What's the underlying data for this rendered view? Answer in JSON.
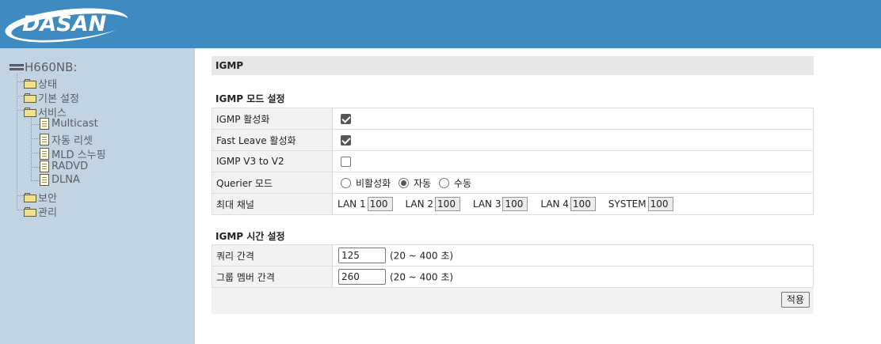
{
  "header": {
    "logo_text": "DASAN",
    "bg_color": "#3d8bc0"
  },
  "sidebar": {
    "root_label": "H660NB:",
    "items": [
      {
        "label": "상태",
        "type": "folder"
      },
      {
        "label": "기본 설정",
        "type": "folder"
      },
      {
        "label": "서비스",
        "type": "folder-open"
      },
      {
        "label": "Multicast",
        "type": "page"
      },
      {
        "label": "자동 리셋",
        "type": "page"
      },
      {
        "label": "MLD 스누핑",
        "type": "page"
      },
      {
        "label": "RADVD",
        "type": "page"
      },
      {
        "label": "DLNA",
        "type": "page"
      },
      {
        "label": "보안",
        "type": "folder"
      },
      {
        "label": "관리",
        "type": "folder"
      }
    ]
  },
  "main": {
    "title": "IGMP",
    "mode_section": {
      "heading": "IGMP 모드 설정",
      "igmp_enable_label": "IGMP 활성화",
      "igmp_enable_checked": true,
      "fast_leave_label": "Fast Leave 활성화",
      "fast_leave_checked": true,
      "v3_to_v2_label": "IGMP V3 to V2",
      "v3_to_v2_checked": false,
      "querier_label": "Querier 모드",
      "querier_options": [
        "비활성화",
        "자동",
        "수동"
      ],
      "querier_selected": "자동",
      "max_channel_label": "최대 채널",
      "channels": [
        {
          "label": "LAN 1",
          "value": "100"
        },
        {
          "label": "LAN 2",
          "value": "100"
        },
        {
          "label": "LAN 3",
          "value": "100"
        },
        {
          "label": "LAN 4",
          "value": "100"
        },
        {
          "label": "SYSTEM",
          "value": "100"
        }
      ]
    },
    "time_section": {
      "heading": "IGMP 시간 설정",
      "query_interval_label": "쿼리 간격",
      "query_interval_value": "125",
      "query_interval_range": "(20 ~ 400 초)",
      "member_interval_label": "그룹 멤버 간격",
      "member_interval_value": "260",
      "member_interval_range": "(20 ~ 400 초)"
    },
    "apply_label": "적용"
  }
}
